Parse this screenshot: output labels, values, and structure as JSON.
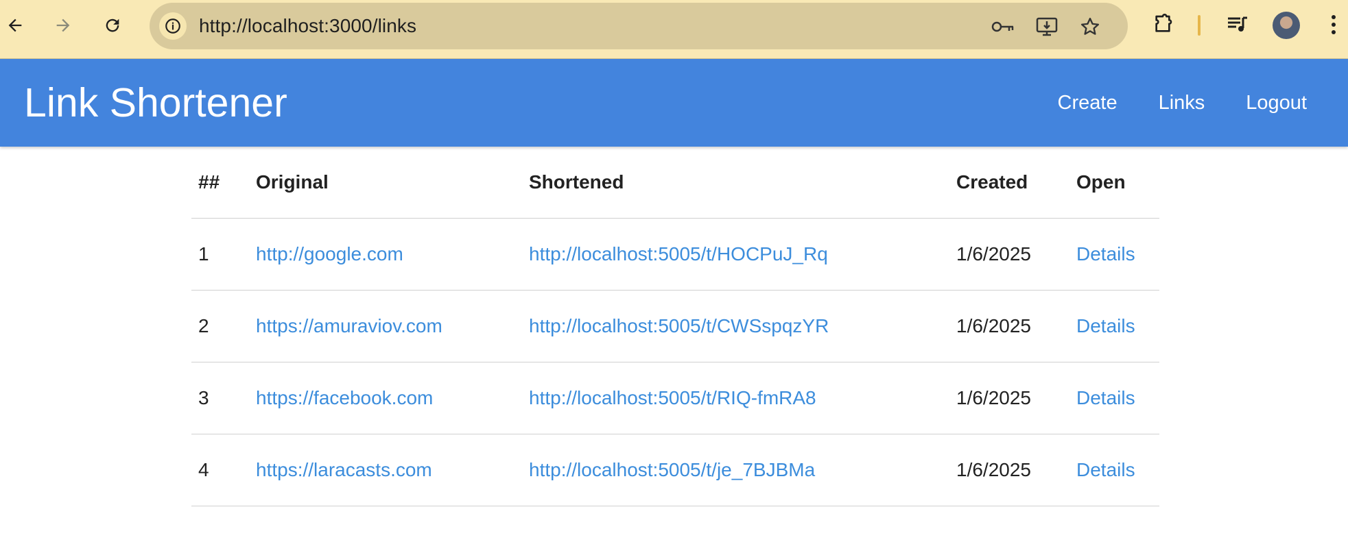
{
  "browser": {
    "url": "http://localhost:3000/links",
    "icons": [
      "back-icon",
      "forward-icon",
      "reload-icon",
      "site-info-icon",
      "key-icon",
      "install-app-icon",
      "star-icon",
      "extensions-icon",
      "media-controls-icon",
      "profile-avatar",
      "menu-icon"
    ],
    "accent": "#f9e9b5"
  },
  "header": {
    "brand": "Link Shortener",
    "nav": [
      {
        "label": "Create"
      },
      {
        "label": "Links"
      },
      {
        "label": "Logout"
      }
    ],
    "color": "#4384dd"
  },
  "table": {
    "columns": [
      "##",
      "Original",
      "Shortened",
      "Created",
      "Open"
    ],
    "rows": [
      {
        "num": "1",
        "original": "http://google.com",
        "shortened": "http://localhost:5005/t/HOCPuJ_Rq",
        "created": "1/6/2025",
        "open": "Details"
      },
      {
        "num": "2",
        "original": "https://amuraviov.com",
        "shortened": "http://localhost:5005/t/CWSspqzYR",
        "created": "1/6/2025",
        "open": "Details"
      },
      {
        "num": "3",
        "original": "https://facebook.com",
        "shortened": "http://localhost:5005/t/RIQ-fmRA8",
        "created": "1/6/2025",
        "open": "Details"
      },
      {
        "num": "4",
        "original": "https://laracasts.com",
        "shortened": "http://localhost:5005/t/je_7BJBMa",
        "created": "1/6/2025",
        "open": "Details"
      }
    ],
    "link_color": "#3c8ddc"
  }
}
